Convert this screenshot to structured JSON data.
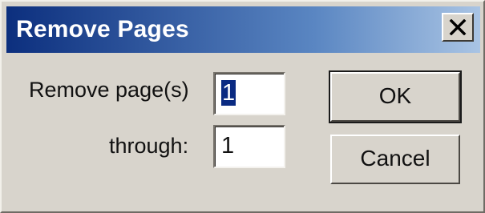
{
  "dialog": {
    "title": "Remove Pages",
    "close_label": "Close",
    "close_icon": "close-icon"
  },
  "form": {
    "remove_label": "Remove page(s)",
    "remove_value": "1",
    "through_label": "through:",
    "through_value": "1"
  },
  "buttons": {
    "ok": "OK",
    "cancel": "Cancel"
  },
  "colors": {
    "title_gradient_start": "#0c2f7e",
    "title_gradient_end": "#a9c4e4",
    "face": "#d8d4cc",
    "selection": "#0a2a82"
  }
}
